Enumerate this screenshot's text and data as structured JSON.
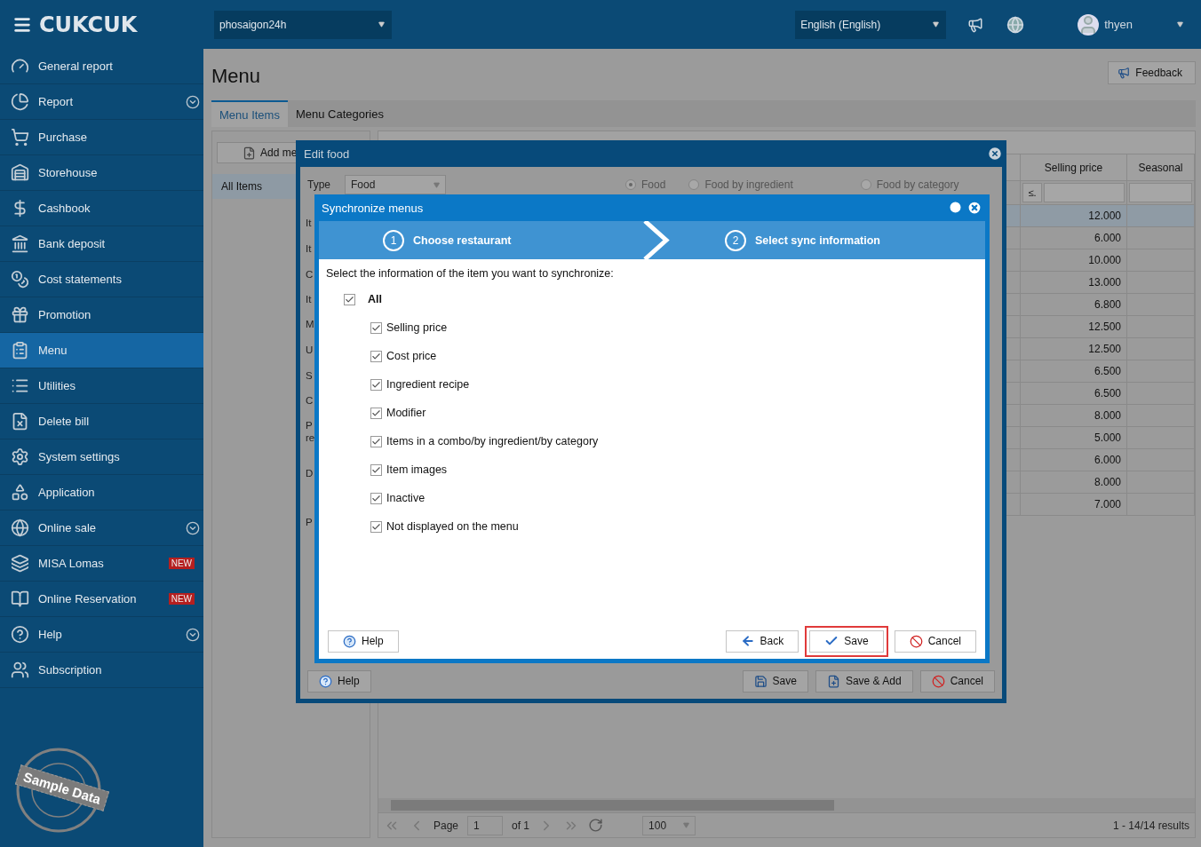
{
  "header": {
    "logo": "CUKCUK",
    "restaurant": "phosaigon24h",
    "language": "English (English)",
    "user": "thyen"
  },
  "sidebar": {
    "items": [
      {
        "label": "General report",
        "selected": false
      },
      {
        "label": "Report",
        "selected": false,
        "expandable": true
      },
      {
        "label": "Purchase",
        "selected": false
      },
      {
        "label": "Storehouse",
        "selected": false
      },
      {
        "label": "Cashbook",
        "selected": false
      },
      {
        "label": "Bank deposit",
        "selected": false
      },
      {
        "label": "Cost statements",
        "selected": false
      },
      {
        "label": "Promotion",
        "selected": false
      },
      {
        "label": "Menu",
        "selected": true
      },
      {
        "label": "Utilities",
        "selected": false
      },
      {
        "label": "Delete bill",
        "selected": false
      },
      {
        "label": "System settings",
        "selected": false
      },
      {
        "label": "Application",
        "selected": false
      },
      {
        "label": "Online sale",
        "selected": false,
        "expandable": true
      },
      {
        "label": "MISA Lomas",
        "selected": false,
        "badge": "NEW"
      },
      {
        "label": "Online Reservation",
        "selected": false,
        "badge": "NEW"
      },
      {
        "label": "Help",
        "selected": false,
        "expandable": true
      },
      {
        "label": "Subscription",
        "selected": false
      }
    ],
    "stamp": "Sample Data"
  },
  "page": {
    "title": "Menu",
    "feedback": "Feedback",
    "tabs": [
      {
        "label": "Menu Items",
        "selected": true
      },
      {
        "label": "Menu Categories",
        "selected": false
      }
    ],
    "left_panel": {
      "add_button": "Add me",
      "items": [
        {
          "label": "All Items",
          "selected": true
        }
      ]
    },
    "table": {
      "columns": [
        "Selling price",
        "Seasonal"
      ],
      "filter_operator": "≤.",
      "rows": [
        {
          "selling_price": "12.000",
          "selected": true
        },
        {
          "selling_price": "6.000",
          "selected": false
        },
        {
          "selling_price": "10.000",
          "selected": false
        },
        {
          "selling_price": "13.000",
          "selected": false
        },
        {
          "selling_price": "6.800",
          "selected": false
        },
        {
          "selling_price": "12.500",
          "selected": false
        },
        {
          "selling_price": "12.500",
          "selected": false
        },
        {
          "selling_price": "6.500",
          "selected": false
        },
        {
          "selling_price": "6.500",
          "selected": false
        },
        {
          "selling_price": "8.000",
          "selected": false
        },
        {
          "selling_price": "5.000",
          "selected": false
        },
        {
          "selling_price": "6.000",
          "selected": false
        },
        {
          "selling_price": "8.000",
          "selected": false
        },
        {
          "selling_price": "7.000",
          "selected": false
        }
      ]
    },
    "pager": {
      "page_label": "Page",
      "page": "1",
      "of": "of 1",
      "page_size": "100",
      "results": "1 - 14/14 results"
    }
  },
  "edit_food": {
    "title": "Edit food",
    "type_label": "Type",
    "type_value": "Food",
    "radios": [
      {
        "label": "Food",
        "selected": true
      },
      {
        "label": "Food by ingredient",
        "selected": false
      },
      {
        "label": "Food by category",
        "selected": false
      }
    ],
    "field_labels": [
      "It",
      "It",
      "C",
      "It",
      "M",
      "U",
      "S",
      "C",
      "P\nre",
      "D",
      "P"
    ],
    "buttons": [
      {
        "label": "Help",
        "kind": "help"
      },
      {
        "label": "Save",
        "kind": "save"
      },
      {
        "label": "Save & Add",
        "kind": "saveadd"
      },
      {
        "label": "Cancel",
        "kind": "cancel"
      }
    ]
  },
  "sync_dialog": {
    "title": "Synchronize menus",
    "steps": [
      {
        "number": "1",
        "label": "Choose restaurant"
      },
      {
        "number": "2",
        "label": "Select sync information"
      }
    ],
    "instruction": "Select the information of the item you want to synchronize:",
    "all": {
      "label": "All",
      "checked": true,
      "children": [
        {
          "label": "Selling price",
          "checked": true
        },
        {
          "label": "Cost price",
          "checked": true
        },
        {
          "label": "Ingredient recipe",
          "checked": true
        },
        {
          "label": "Modifier",
          "checked": true
        },
        {
          "label": "Items in a combo/by ingredient/by category",
          "checked": true
        },
        {
          "label": "Item images",
          "checked": true
        },
        {
          "label": "Inactive",
          "checked": true
        },
        {
          "label": "Not displayed on the menu",
          "checked": true
        }
      ]
    },
    "buttons": [
      {
        "label": "Help",
        "kind": "help",
        "highlighted": false
      },
      {
        "label": "Back",
        "kind": "back",
        "highlighted": false
      },
      {
        "label": "Save",
        "kind": "check",
        "highlighted": true
      },
      {
        "label": "Cancel",
        "kind": "cancel",
        "highlighted": false
      }
    ]
  }
}
